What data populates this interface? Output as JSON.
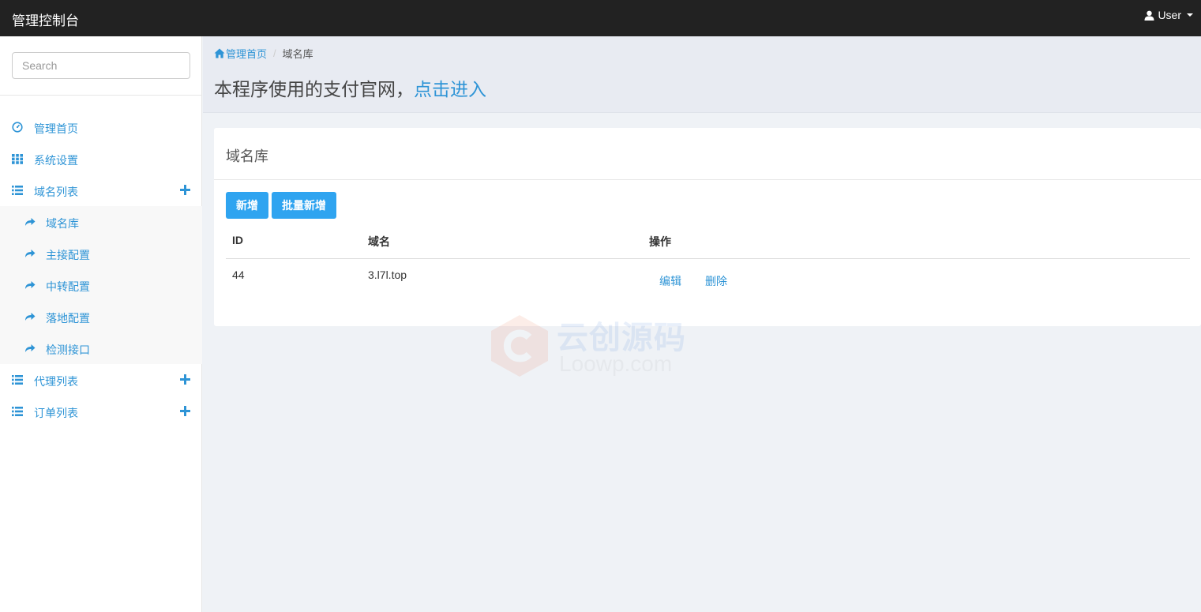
{
  "app": {
    "title": "管理控制台",
    "user_label": "User"
  },
  "sidebar": {
    "search_placeholder": "Search",
    "items": [
      {
        "label": "管理首页",
        "icon": "dashboard-icon"
      },
      {
        "label": "系统设置",
        "icon": "grid-icon"
      },
      {
        "label": "域名列表",
        "icon": "list-icon",
        "expandable": true
      },
      {
        "label": "代理列表",
        "icon": "list-icon",
        "expandable": true
      },
      {
        "label": "订单列表",
        "icon": "list-icon",
        "expandable": true
      }
    ],
    "sub_items": [
      {
        "label": "域名库",
        "icon": "share-arrow-icon"
      },
      {
        "label": "主接配置",
        "icon": "share-arrow-icon"
      },
      {
        "label": "中转配置",
        "icon": "share-arrow-icon"
      },
      {
        "label": "落地配置",
        "icon": "share-arrow-icon"
      },
      {
        "label": "检测接口",
        "icon": "share-arrow-icon"
      }
    ]
  },
  "breadcrumb": {
    "home": "管理首页",
    "current": "域名库"
  },
  "header": {
    "title_text": "本程序使用的支付官网，",
    "title_link": "点击进入"
  },
  "panel": {
    "title": "域名库",
    "add_button": "新增",
    "batch_button": "批量新增",
    "columns": [
      "ID",
      "域名",
      "操作"
    ],
    "rows": [
      {
        "id": "44",
        "domain": "3.l7l.top",
        "edit": "编辑",
        "delete": "删除"
      }
    ]
  },
  "watermark": {
    "text": "云创源码",
    "sub": "Loowp.com"
  },
  "colors": {
    "accent": "#2e94d6",
    "button": "#2fa4f0",
    "topbar": "#222222",
    "background": "#eff2f6"
  }
}
